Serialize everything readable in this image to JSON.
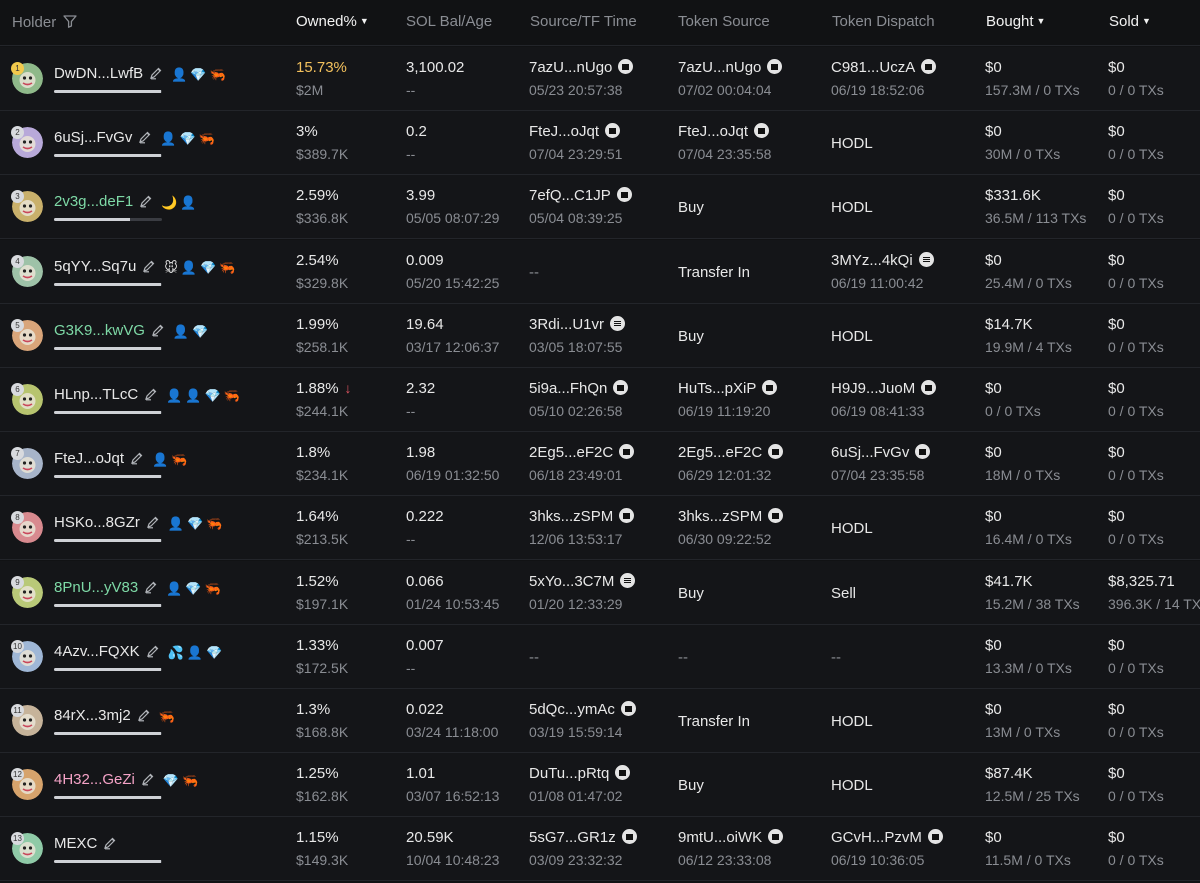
{
  "header": {
    "holder": "Holder",
    "owned": "Owned%",
    "sol_bal_age": "SOL Bal/Age",
    "source_tf_time": "Source/TF Time",
    "token_source": "Token Source",
    "token_dispatch": "Token Dispatch",
    "bought": "Bought",
    "sold": "Sold"
  },
  "rows": [
    {
      "rank": "1",
      "name": "DwDN...LwfB",
      "color": "#e8e8e8",
      "badges": [
        "👤",
        "💎",
        "🦐"
      ],
      "bar": 0.99,
      "pct": "15.73%",
      "usd": "$2M",
      "sol": "3,100.02",
      "age": "--",
      "src": "7azU...nUgo",
      "src_time": "05/23 20:57:38",
      "tsrc": "7azU...nUgo",
      "tsrc_time": "07/02 00:04:04",
      "disp": "C981...UczA",
      "disp_time": "06/19 18:52:06",
      "bought": "$0",
      "bought_sub": "157.3M / 0 TXs",
      "sold": "$0",
      "sold_sub": "0 / 0 TXs"
    },
    {
      "rank": "2",
      "name": "6uSj...FvGv",
      "color": "#e8e8e8",
      "badges": [
        "👤",
        "💎",
        "🦐"
      ],
      "bar": 0.99,
      "pct": "3%",
      "usd": "$389.7K",
      "sol": "0.2",
      "age": "--",
      "src": "FteJ...oJqt",
      "src_time": "07/04 23:29:51",
      "tsrc": "FteJ...oJqt",
      "tsrc_time": "07/04 23:35:58",
      "disp": "HODL",
      "disp_time": "",
      "bought": "$0",
      "bought_sub": "30M / 0 TXs",
      "sold": "$0",
      "sold_sub": "0 / 0 TXs"
    },
    {
      "rank": "3",
      "name": "2v3g...deF1",
      "color": "#7ed9a6",
      "badges": [
        "🌙",
        "👤"
      ],
      "bar": 0.7,
      "pct": "2.59%",
      "usd": "$336.8K",
      "sol": "3.99",
      "age": "05/05 08:07:29",
      "src": "7efQ...C1JP",
      "src_time": "05/04 08:39:25",
      "tsrc": "Buy",
      "tsrc_time": "",
      "disp": "HODL",
      "disp_time": "",
      "bought": "$331.6K",
      "bought_sub": "36.5M / 113 TXs",
      "sold": "$0",
      "sold_sub": "0 / 0 TXs"
    },
    {
      "rank": "4",
      "name": "5qYY...Sq7u",
      "color": "#e8e8e8",
      "badges": [
        "🐭",
        "👤",
        "💎",
        "🦐"
      ],
      "bar": 0.99,
      "pct": "2.54%",
      "usd": "$329.8K",
      "sol": "0.009",
      "age": "05/20 15:42:25",
      "src": "--",
      "src_time": "",
      "tsrc": "Transfer In",
      "tsrc_time": "",
      "disp": "3MYz...4kQi",
      "disp_time": "06/19 11:00:42",
      "bought": "$0",
      "bought_sub": "25.4M / 0 TXs",
      "sold": "$0",
      "sold_sub": "0 / 0 TXs"
    },
    {
      "rank": "5",
      "name": "G3K9...kwVG",
      "color": "#7ed9a6",
      "badges": [
        "👤",
        "💎"
      ],
      "bar": 0.99,
      "pct": "1.99%",
      "usd": "$258.1K",
      "sol": "19.64",
      "age": "03/17 12:06:37",
      "src": "3Rdi...U1vr",
      "src_time": "03/05 18:07:55",
      "tsrc": "Buy",
      "tsrc_time": "",
      "disp": "HODL",
      "disp_time": "",
      "bought": "$14.7K",
      "bought_sub": "19.9M / 4 TXs",
      "sold": "$0",
      "sold_sub": "0 / 0 TXs"
    },
    {
      "rank": "6",
      "name": "HLnp...TLcC",
      "color": "#e8e8e8",
      "badges": [
        "👤",
        "👤",
        "💎",
        "🦐"
      ],
      "bar": 0.99,
      "pct": "1.88%",
      "usd": "$244.1K",
      "sol": "2.32",
      "age": "--",
      "src": "5i9a...FhQn",
      "src_time": "05/10 02:26:58",
      "tsrc": "HuTs...pXiP",
      "tsrc_time": "06/19 11:19:20",
      "disp": "H9J9...JuoM",
      "disp_time": "06/19 08:41:33",
      "bought": "$0",
      "bought_sub": "0 / 0 TXs",
      "sold": "$0",
      "sold_sub": "0 / 0 TXs"
    },
    {
      "rank": "7",
      "name": "FteJ...oJqt",
      "color": "#e8e8e8",
      "badges": [
        "👤",
        "🦐"
      ],
      "bar": 0.99,
      "pct": "1.8%",
      "usd": "$234.1K",
      "sol": "1.98",
      "age": "06/19 01:32:50",
      "src": "2Eg5...eF2C",
      "src_time": "06/18 23:49:01",
      "tsrc": "2Eg5...eF2C",
      "tsrc_time": "06/29 12:01:32",
      "disp": "6uSj...FvGv",
      "disp_time": "07/04 23:35:58",
      "bought": "$0",
      "bought_sub": "18M / 0 TXs",
      "sold": "$0",
      "sold_sub": "0 / 0 TXs"
    },
    {
      "rank": "8",
      "name": "HSKo...8GZr",
      "color": "#e8e8e8",
      "badges": [
        "👤",
        "💎",
        "🦐"
      ],
      "bar": 0.99,
      "pct": "1.64%",
      "usd": "$213.5K",
      "sol": "0.222",
      "age": "--",
      "src": "3hks...zSPM",
      "src_time": "12/06 13:53:17",
      "tsrc": "3hks...zSPM",
      "tsrc_time": "06/30 09:22:52",
      "disp": "HODL",
      "disp_time": "",
      "bought": "$0",
      "bought_sub": "16.4M / 0 TXs",
      "sold": "$0",
      "sold_sub": "0 / 0 TXs"
    },
    {
      "rank": "9",
      "name": "8PnU...yV83",
      "color": "#7ed9a6",
      "badges": [
        "👤",
        "💎",
        "🦐"
      ],
      "bar": 0.99,
      "pct": "1.52%",
      "usd": "$197.1K",
      "sol": "0.066",
      "age": "01/24 10:53:45",
      "src": "5xYo...3C7M",
      "src_time": "01/20 12:33:29",
      "tsrc": "Buy",
      "tsrc_time": "",
      "disp": "Sell",
      "disp_time": "",
      "bought": "$41.7K",
      "bought_sub": "15.2M / 38 TXs",
      "sold": "$8,325.71",
      "sold_sub": "396.3K / 14 TX"
    },
    {
      "rank": "10",
      "name": "4Azv...FQXK",
      "color": "#e8e8e8",
      "badges": [
        "💦",
        "👤",
        "💎"
      ],
      "bar": 0.99,
      "pct": "1.33%",
      "usd": "$172.5K",
      "sol": "0.007",
      "age": "--",
      "src": "--",
      "src_time": "",
      "tsrc": "--",
      "tsrc_time": "",
      "disp": "--",
      "disp_time": "",
      "bought": "$0",
      "bought_sub": "13.3M / 0 TXs",
      "sold": "$0",
      "sold_sub": "0 / 0 TXs"
    },
    {
      "rank": "11",
      "name": "84rX...3mj2",
      "color": "#e8e8e8",
      "badges": [
        "🦐"
      ],
      "bar": 0.99,
      "pct": "1.3%",
      "usd": "$168.8K",
      "sol": "0.022",
      "age": "03/24 11:18:00",
      "src": "5dQc...ymAc",
      "src_time": "03/19 15:59:14",
      "tsrc": "Transfer In",
      "tsrc_time": "",
      "disp": "HODL",
      "disp_time": "",
      "bought": "$0",
      "bought_sub": "13M / 0 TXs",
      "sold": "$0",
      "sold_sub": "0 / 0 TXs"
    },
    {
      "rank": "12",
      "name": "4H32...GeZi",
      "color": "#f5a3c7",
      "badges": [
        "💎",
        "🦐"
      ],
      "bar": 0.99,
      "pct": "1.25%",
      "usd": "$162.8K",
      "sol": "1.01",
      "age": "03/07 16:52:13",
      "src": "DuTu...pRtq",
      "src_time": "01/08 01:47:02",
      "tsrc": "Buy",
      "tsrc_time": "",
      "disp": "HODL",
      "disp_time": "",
      "bought": "$87.4K",
      "bought_sub": "12.5M / 25 TXs",
      "sold": "$0",
      "sold_sub": "0 / 0 TXs"
    },
    {
      "rank": "13",
      "name": "MEXC",
      "color": "#e8e8e8",
      "badges": [],
      "bar": 0.99,
      "pct": "1.15%",
      "usd": "$149.3K",
      "sol": "20.59K",
      "age": "10/04 10:48:23",
      "src": "5sG7...GR1z",
      "src_time": "03/09 23:32:32",
      "tsrc": "9mtU...oiWK",
      "tsrc_time": "06/12 23:33:08",
      "disp": "GCvH...PzvM",
      "disp_time": "06/19 10:36:05",
      "bought": "$0",
      "bought_sub": "11.5M / 0 TXs",
      "sold": "$0",
      "sold_sub": "0 / 0 TXs"
    }
  ]
}
